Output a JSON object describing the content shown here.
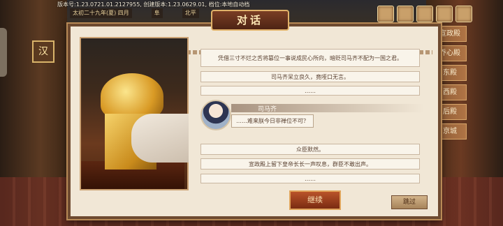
{
  "version_text": "版本号:1.23.0721.01.2127955, 创建版本:1.23.0629.01, 档位:本地自动档",
  "topbar": {
    "date": "太初二十九年(夏) 四月",
    "item2": "阜",
    "item3": "北平"
  },
  "side_menu": [
    "宣政殿",
    "乔心殿",
    "东殿",
    "西殿",
    "后殿",
    "京城"
  ],
  "left_badge": "汉",
  "dialog": {
    "title": "对话",
    "lines_top": [
      "凭借三寸不烂之舌将篡位一事说成民心所向，暗贬司马齐不配为一国之君。",
      "司马齐呆立良久，竟哑口无言。",
      "……"
    ],
    "speaker": {
      "name": "司马齐",
      "speech": "……难来朕今日非禅位不可？"
    },
    "lines_bottom": [
      "众臣默然。",
      "宣政殿上留下皇帝长长一声叹息，群臣不敢出声。",
      "……"
    ],
    "continue_label": "继续",
    "skip_label": "跳过"
  },
  "colors": {
    "accent": "#7a3e24",
    "panel_bg": "#f1e7d6",
    "border": "#6e4a30"
  }
}
